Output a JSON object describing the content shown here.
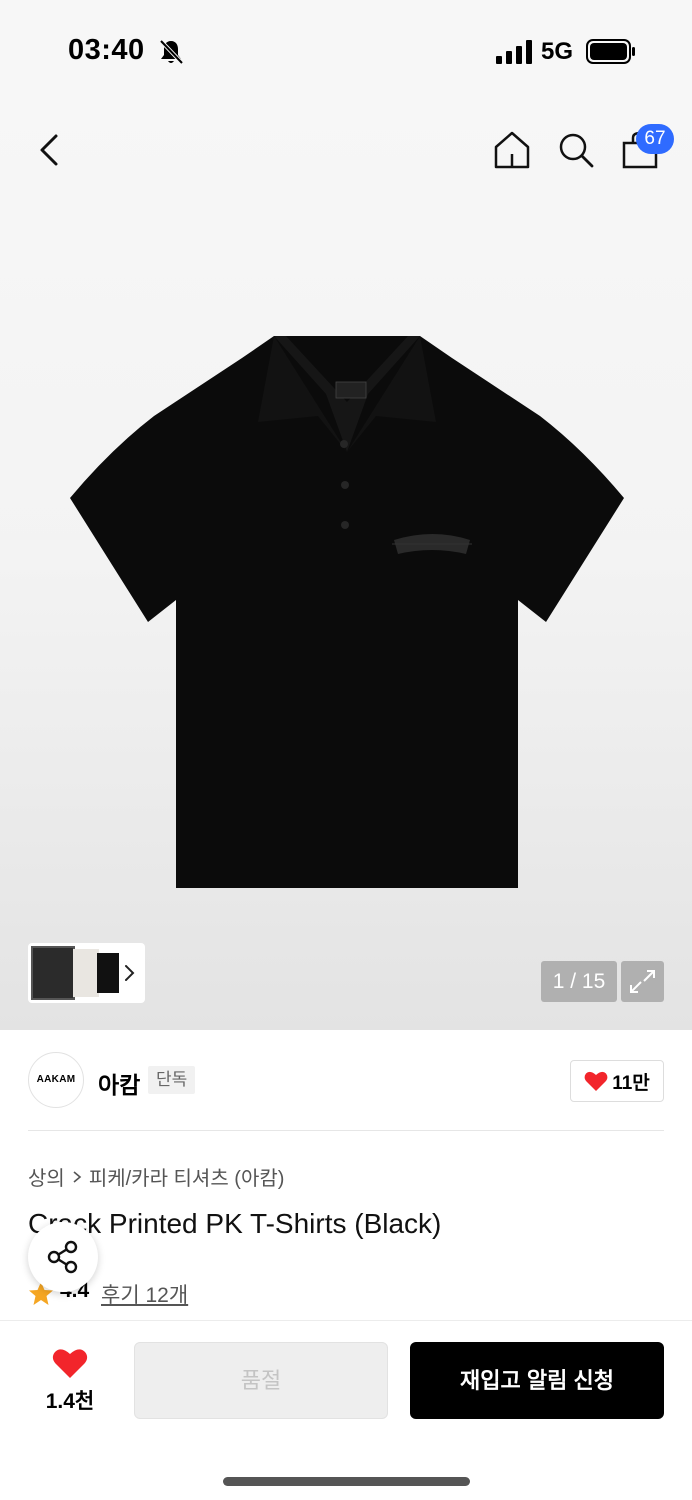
{
  "status_bar": {
    "time": "03:40",
    "network": "5G"
  },
  "nav": {
    "cart_count": "67"
  },
  "gallery": {
    "counter": "1 / 15"
  },
  "brand": {
    "logo_text": "AAKAM",
    "name": "아캄",
    "tag": "단독",
    "likes": "11만"
  },
  "breadcrumb": {
    "category": "상의",
    "subcategory": "피케/카라 티셔츠 (아캄)"
  },
  "product": {
    "title": "Crack Printed PK T-Shirts (Black)",
    "rating": "4.4",
    "reviews": "후기 12개"
  },
  "bottom_bar": {
    "wish_count": "1.4천",
    "soldout_label": "품절",
    "restock_label": "재입고 알림 신청"
  },
  "colors": {
    "accent_blue": "#2f6bff",
    "heart_red": "#f2252b",
    "star_orange": "#f5a623"
  }
}
